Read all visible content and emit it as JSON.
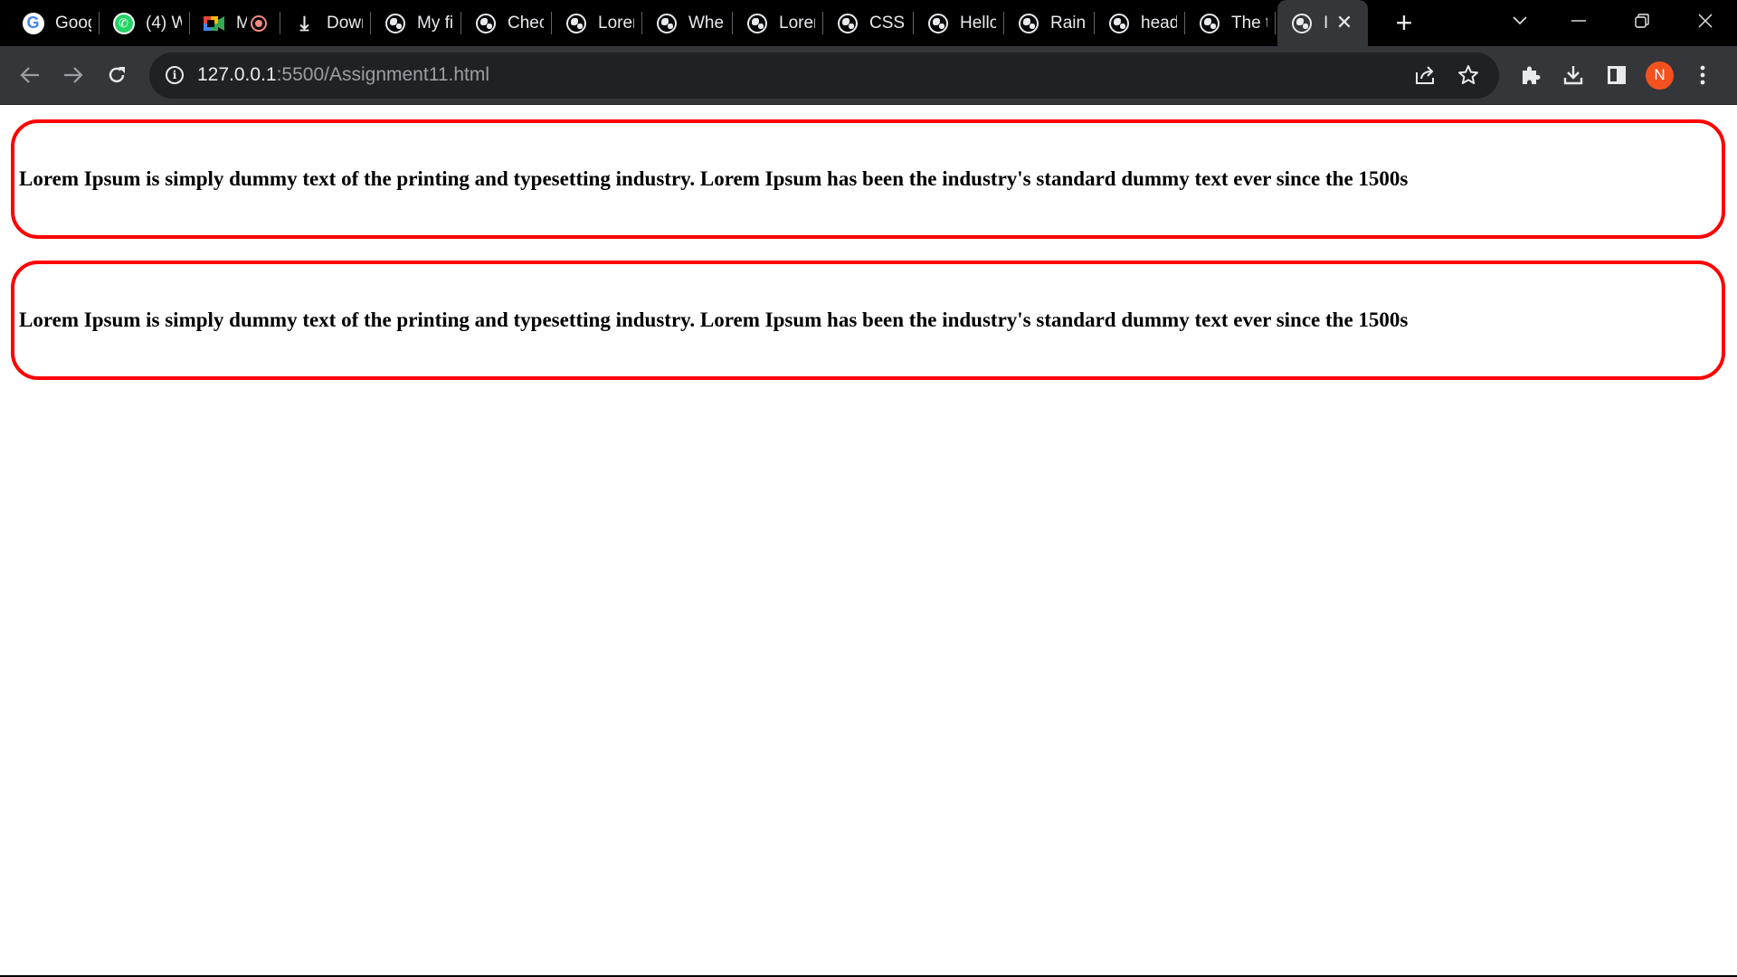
{
  "browser": {
    "tabs": [
      {
        "title": "Goog",
        "icon": "google-icon"
      },
      {
        "title": "(4) W",
        "icon": "whatsapp-icon"
      },
      {
        "title": "M",
        "icon": "meet-icon",
        "recording": true
      },
      {
        "title": "Down",
        "icon": "download-icon"
      },
      {
        "title": "My fi",
        "icon": "globe-icon"
      },
      {
        "title": "Chec",
        "icon": "globe-icon"
      },
      {
        "title": "Lorer",
        "icon": "globe-icon"
      },
      {
        "title": "Wher",
        "icon": "globe-icon"
      },
      {
        "title": "Lorer",
        "icon": "globe-icon"
      },
      {
        "title": "CSS e",
        "icon": "globe-icon"
      },
      {
        "title": "Hello",
        "icon": "globe-icon"
      },
      {
        "title": "Rainb",
        "icon": "globe-icon"
      },
      {
        "title": "head",
        "icon": "globe-icon"
      },
      {
        "title": "The t",
        "icon": "globe-icon"
      }
    ],
    "active_tab": {
      "title": "I",
      "icon": "globe-icon"
    },
    "address_bar": {
      "host": "127.0.0.1",
      "rest": ":5500/Assignment11.html"
    },
    "profile_initial": "N"
  },
  "page": {
    "boxes": [
      {
        "text": "Lorem Ipsum is simply dummy text of the printing and typesetting industry. Lorem Ipsum has been the industry's standard dummy text ever since the 1500s"
      },
      {
        "text": "Lorem Ipsum is simply dummy text of the printing and typesetting industry. Lorem Ipsum has been the industry's standard dummy text ever since the 1500s"
      }
    ],
    "border_color": "#ff0000"
  },
  "colors": {
    "tabstrip_bg": "#000000",
    "toolbar_bg": "#35363a",
    "omnibox_bg": "#202124",
    "avatar_bg": "#f4511e"
  }
}
